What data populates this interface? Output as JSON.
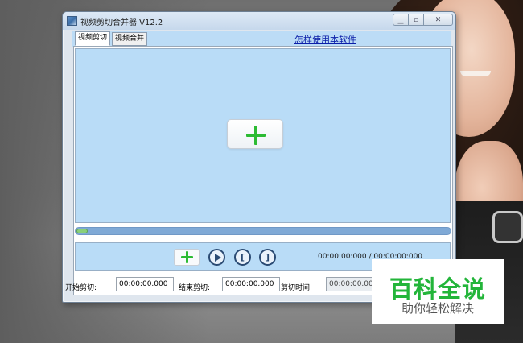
{
  "window": {
    "title": "视频剪切合并器 V12.2"
  },
  "tabs": [
    {
      "label": "视频剪切",
      "active": true
    },
    {
      "label": "视频合并",
      "active": false
    }
  ],
  "help_link": "怎样使用本软件",
  "progress": {
    "value": 0.02
  },
  "controls": {
    "time_display": "00:00:00:000 / 00:00:00:000"
  },
  "fields": {
    "start_label": "开始剪切:",
    "start_value": "00:00:00.000",
    "end_label": "结束剪切:",
    "end_value": "00:00:00.000",
    "duration_label": "剪切时间:",
    "duration_value": "00:00:00.000"
  },
  "watermark": {
    "title": "百科全说",
    "subtitle": "助你轻松解决"
  },
  "icons": {
    "app": "video-app-icon",
    "add": "plus-icon",
    "play": "play-icon",
    "mark_start": "bracket-left-icon",
    "mark_end": "bracket-right-icon"
  },
  "colors": {
    "panel_blue": "#b9dcf7",
    "accent_green": "#2cbb33",
    "link_blue": "#0b1ea8",
    "progress_blue": "#7fa9d6"
  }
}
